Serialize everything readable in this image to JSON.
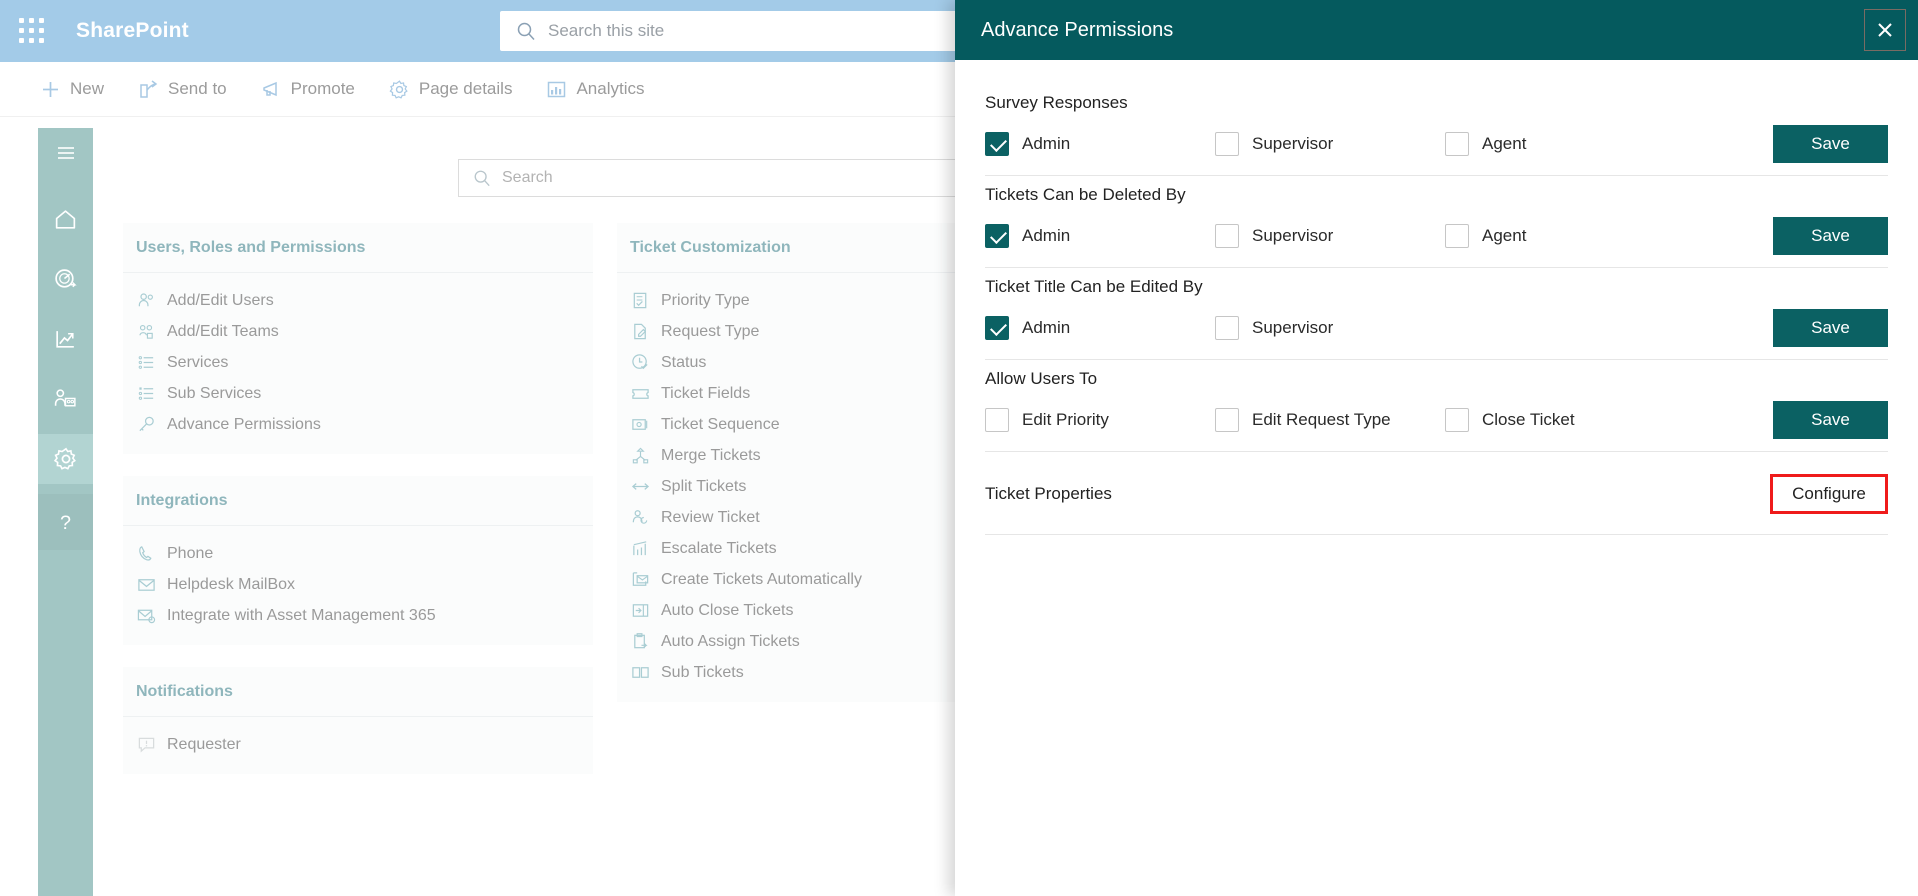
{
  "suite": {
    "waffle_icon": "app-launcher-icon",
    "brand": "SharePoint",
    "search_placeholder": "Search this site",
    "search_icon": "search-icon"
  },
  "command_bar": {
    "items": [
      {
        "label": "New",
        "icon": "plus-icon"
      },
      {
        "label": "Send to",
        "icon": "share-icon"
      },
      {
        "label": "Promote",
        "icon": "megaphone-icon"
      },
      {
        "label": "Page details",
        "icon": "gear-icon"
      },
      {
        "label": "Analytics",
        "icon": "chart-bar-icon"
      }
    ]
  },
  "rail": {
    "items": [
      {
        "icon": "hamburger-menu-icon",
        "name": "menu",
        "active": false
      },
      {
        "icon": "home-icon",
        "name": "home",
        "active": false
      },
      {
        "icon": "dashboard-gauge-icon",
        "name": "dashboard",
        "active": false
      },
      {
        "icon": "trending-chart-icon",
        "name": "reports",
        "active": false
      },
      {
        "icon": "user-presenter-icon",
        "name": "agents",
        "active": false
      },
      {
        "icon": "gear-icon",
        "name": "settings",
        "active": true
      },
      {
        "icon": "question-mark-icon",
        "name": "help",
        "active": false
      }
    ]
  },
  "page": {
    "search_placeholder": "Search",
    "search_icon": "search-icon",
    "columns": [
      {
        "cards": [
          {
            "title": "Users, Roles and Permissions",
            "items": [
              {
                "label": "Add/Edit Users",
                "icon": "users-icon"
              },
              {
                "label": "Add/Edit Teams",
                "icon": "team-icon"
              },
              {
                "label": "Services",
                "icon": "list-icon"
              },
              {
                "label": "Sub Services",
                "icon": "sub-list-icon"
              },
              {
                "label": "Advance Permissions",
                "icon": "key-icon"
              }
            ]
          },
          {
            "title": "Integrations",
            "items": [
              {
                "label": "Phone",
                "icon": "phone-icon"
              },
              {
                "label": "Helpdesk MailBox",
                "icon": "envelope-icon"
              },
              {
                "label": "Integrate with Asset Management 365",
                "icon": "envelope-gear-icon"
              }
            ]
          },
          {
            "title": "Notifications",
            "items": [
              {
                "label": "Requester",
                "icon": "comment-alert-icon"
              }
            ]
          }
        ]
      },
      {
        "cards": [
          {
            "title": "Ticket Customization",
            "items": [
              {
                "label": "Priority Type",
                "icon": "checklist-icon"
              },
              {
                "label": "Request Type",
                "icon": "edit-document-icon"
              },
              {
                "label": "Status",
                "icon": "clock-check-icon"
              },
              {
                "label": "Ticket Fields",
                "icon": "ticket-icon"
              },
              {
                "label": "Ticket Sequence",
                "icon": "sequence-icon"
              },
              {
                "label": "Merge Tickets",
                "icon": "merge-icon"
              },
              {
                "label": "Split Tickets",
                "icon": "split-arrows-icon"
              },
              {
                "label": "Review Ticket",
                "icon": "user-review-icon"
              },
              {
                "label": "Escalate Tickets",
                "icon": "escalate-chart-icon"
              },
              {
                "label": "Create Tickets Automatically",
                "icon": "auto-create-icon"
              },
              {
                "label": "Auto Close Tickets",
                "icon": "auto-close-icon"
              },
              {
                "label": "Auto Assign Tickets",
                "icon": "clipboard-assign-icon"
              },
              {
                "label": "Sub Tickets",
                "icon": "sub-tickets-icon"
              }
            ]
          }
        ]
      }
    ]
  },
  "drawer": {
    "title": "Advance Permissions",
    "close_icon": "close-icon",
    "save_label": "Save",
    "configure_label": "Configure",
    "rows": [
      {
        "label": "Survey Responses",
        "options": [
          {
            "label": "Admin",
            "checked": true
          },
          {
            "label": "Supervisor",
            "checked": false
          },
          {
            "label": "Agent",
            "checked": false
          }
        ],
        "action": "Save"
      },
      {
        "label": "Tickets Can be Deleted By",
        "options": [
          {
            "label": "Admin",
            "checked": true
          },
          {
            "label": "Supervisor",
            "checked": false
          },
          {
            "label": "Agent",
            "checked": false
          }
        ],
        "action": "Save"
      },
      {
        "label": "Ticket Title Can be Edited By",
        "options": [
          {
            "label": "Admin",
            "checked": true
          },
          {
            "label": "Supervisor",
            "checked": false
          }
        ],
        "action": "Save"
      },
      {
        "label": "Allow Users To",
        "options": [
          {
            "label": "Edit Priority",
            "checked": false
          },
          {
            "label": "Edit Request Type",
            "checked": false
          },
          {
            "label": "Close Ticket",
            "checked": false
          }
        ],
        "action": "Save"
      }
    ],
    "ticket_properties": {
      "label": "Ticket Properties",
      "action": "Configure",
      "highlighted": true
    }
  },
  "colors": {
    "suite_bar": "#a3cbe8",
    "drawer_header": "#055a5e",
    "accent_teal": "#0b6163",
    "rail": "#a2c6c4",
    "highlight_red": "#ef1b1b",
    "card_title": "#8fb6bc"
  }
}
